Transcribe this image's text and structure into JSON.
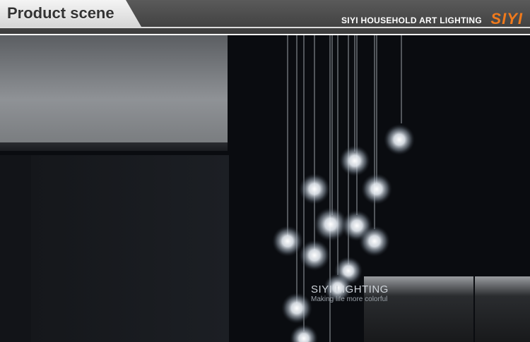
{
  "banner": {
    "title": "Product scene",
    "brand_subtitle": "SIYI HOUSEHOLD ART LIGHTING",
    "brand_logo": "SIYI",
    "logo_color": "#f07a1c"
  },
  "watermark": {
    "title": "SIYI LIGHTING",
    "slogan": "Making life more colorful"
  }
}
